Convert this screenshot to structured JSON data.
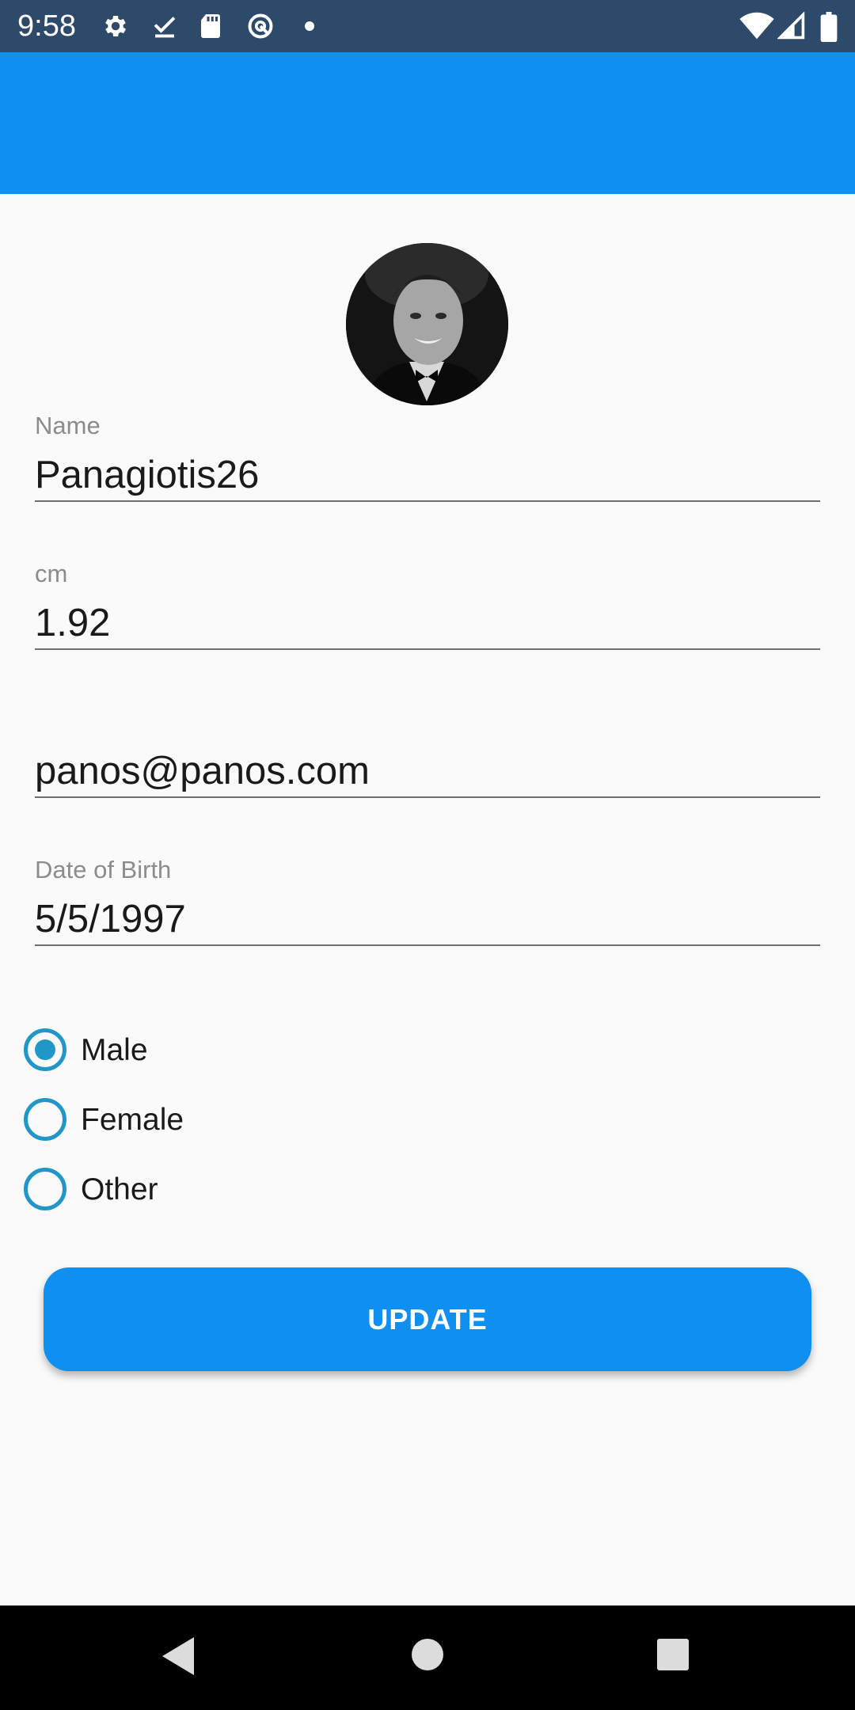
{
  "status_bar": {
    "time": "9:58",
    "left_icons": [
      "settings-icon",
      "download-done-icon",
      "sd-card-icon",
      "at-sign-icon",
      "dot-icon"
    ],
    "right_icons": [
      "wifi-icon",
      "signal-icon",
      "battery-icon"
    ]
  },
  "colors": {
    "app_bar": "#0f8fef",
    "status_bar": "#2e4a6b",
    "accent": "#2196c8",
    "button": "#0f8fef"
  },
  "profile": {
    "avatar_icon": "profile-photo"
  },
  "form": {
    "name": {
      "label": "Name",
      "value": "Panagiotis26"
    },
    "height": {
      "label": "cm",
      "value": "1.92"
    },
    "email": {
      "label": "",
      "value": "panos@panos.com"
    },
    "dob": {
      "label": "Date of Birth",
      "value": "5/5/1997"
    }
  },
  "gender": {
    "selected": "Male",
    "options": [
      "Male",
      "Female",
      "Other"
    ]
  },
  "update_button": {
    "label": "UPDATE"
  },
  "nav_bar": {
    "icons": [
      "back-icon",
      "home-icon",
      "recents-icon"
    ]
  }
}
